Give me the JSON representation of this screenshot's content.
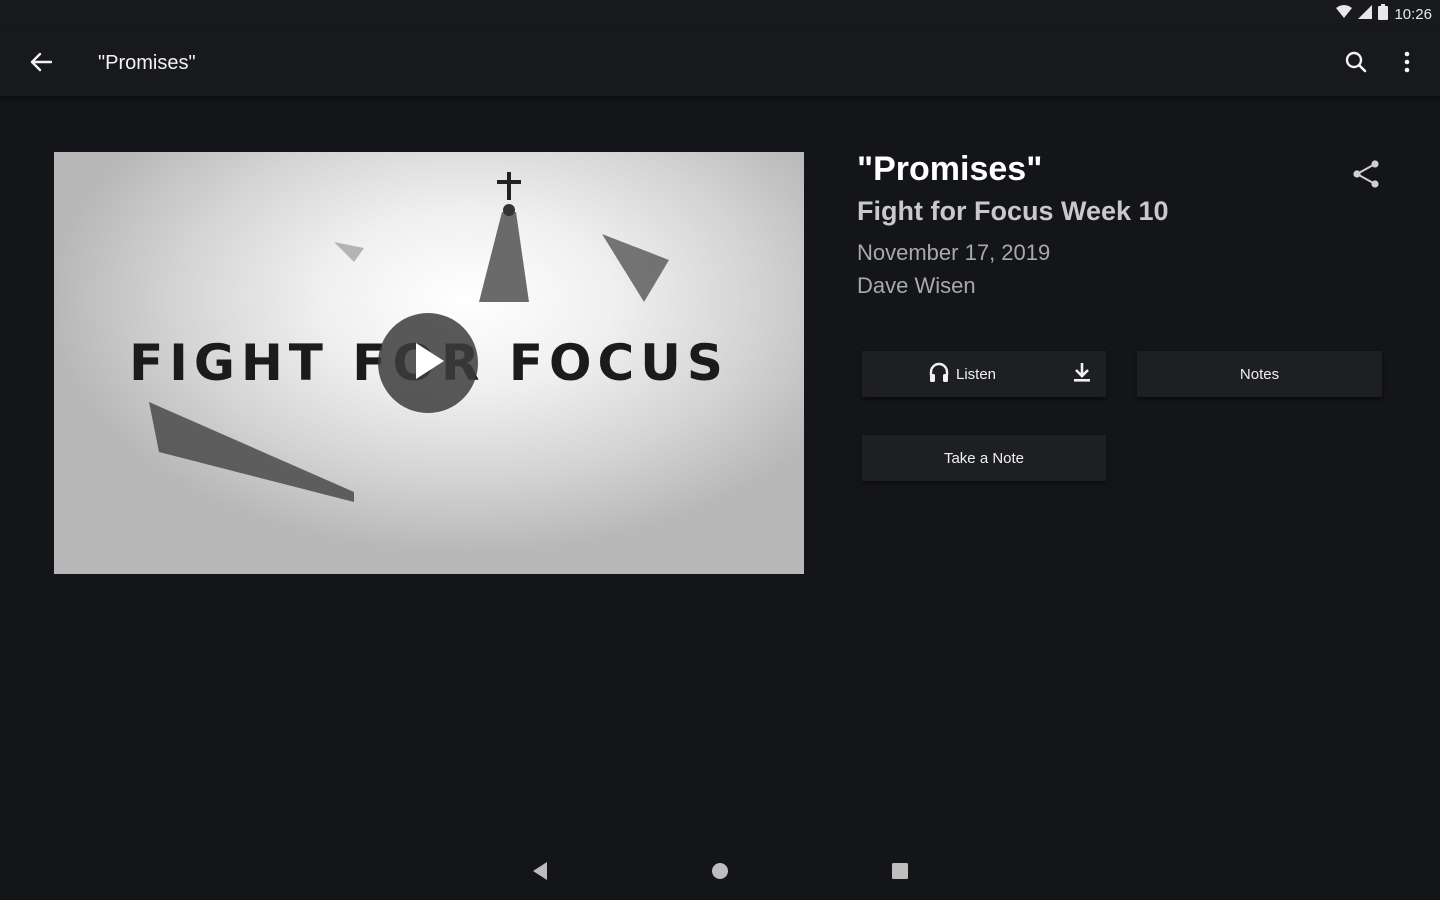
{
  "status_bar": {
    "time": "10:26",
    "icons": [
      "wifi-icon",
      "signal-icon",
      "battery-icon"
    ]
  },
  "app_bar": {
    "title": "\"Promises\"",
    "back_icon": "arrow-back-icon",
    "search_icon": "search-icon",
    "more_icon": "more-vert-icon"
  },
  "media": {
    "thumbnail_text": "FIGHT FOR FOCUS",
    "play_icon": "play-icon"
  },
  "sermon": {
    "title": "\"Promises\"",
    "series": "Fight for Focus Week 10",
    "date": "November 17, 2019",
    "speaker": "Dave Wisen",
    "share_icon": "share-icon"
  },
  "actions": {
    "listen_label": "Listen",
    "notes_label": "Notes",
    "take_note_label": "Take a Note",
    "headphones_icon": "headphones-icon",
    "download_icon": "download-icon"
  },
  "nav_bar": {
    "icons": [
      "nav-back-icon",
      "nav-home-icon",
      "nav-recents-icon"
    ]
  },
  "colors": {
    "background": "#141519",
    "app_bar": "#18191c",
    "button": "#1e1f22",
    "secondary_text": "#c9c9c9",
    "tertiary_text": "#a9a9a9"
  }
}
